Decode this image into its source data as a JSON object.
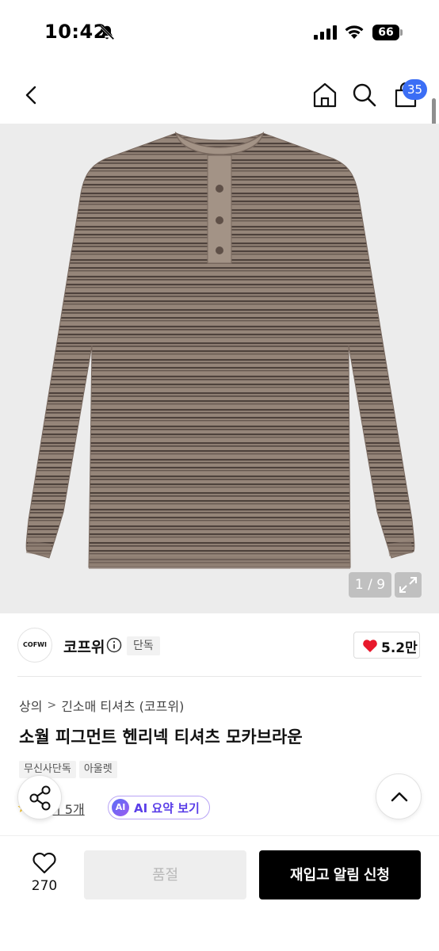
{
  "status_bar": {
    "time": "10:42",
    "battery": "66",
    "icons": [
      "bell-slash-icon",
      "signal-icon",
      "wifi-icon",
      "battery-icon"
    ]
  },
  "nav": {
    "icons": [
      "back-arrow-icon",
      "home-icon",
      "search-icon",
      "cart-icon"
    ],
    "cart_count": "35"
  },
  "gallery": {
    "counter": "1 / 9",
    "expand_icon": "expand-icon"
  },
  "brand": {
    "logo_text": "COFWI",
    "name": "코프위",
    "exclusive_tag": "단독",
    "likes": "5.2만"
  },
  "breadcrumb": {
    "category": "상의",
    "subcategory": "긴소매 티셔츠 (코프위)"
  },
  "product": {
    "title": "소월 피그먼트 헨리넥 티셔츠 모카브라운",
    "tags": [
      "무신사단독",
      "아울렛"
    ]
  },
  "review": {
    "text": "후기 5개",
    "visible_text": "기 5개"
  },
  "ai_summary": {
    "badge": "AI",
    "label": "AI 요약 보기"
  },
  "bottom_bar": {
    "wish_count": "270",
    "soldout_label": "품절",
    "restock_label": "재입고 알림 신청"
  },
  "colors": {
    "accent_blue": "#3b6ef5",
    "heart_red": "#e8192c",
    "ai_purple": "#5a3ee8",
    "shirt_base": "#8a7a70",
    "shirt_stripe": "#4b3f3a"
  }
}
